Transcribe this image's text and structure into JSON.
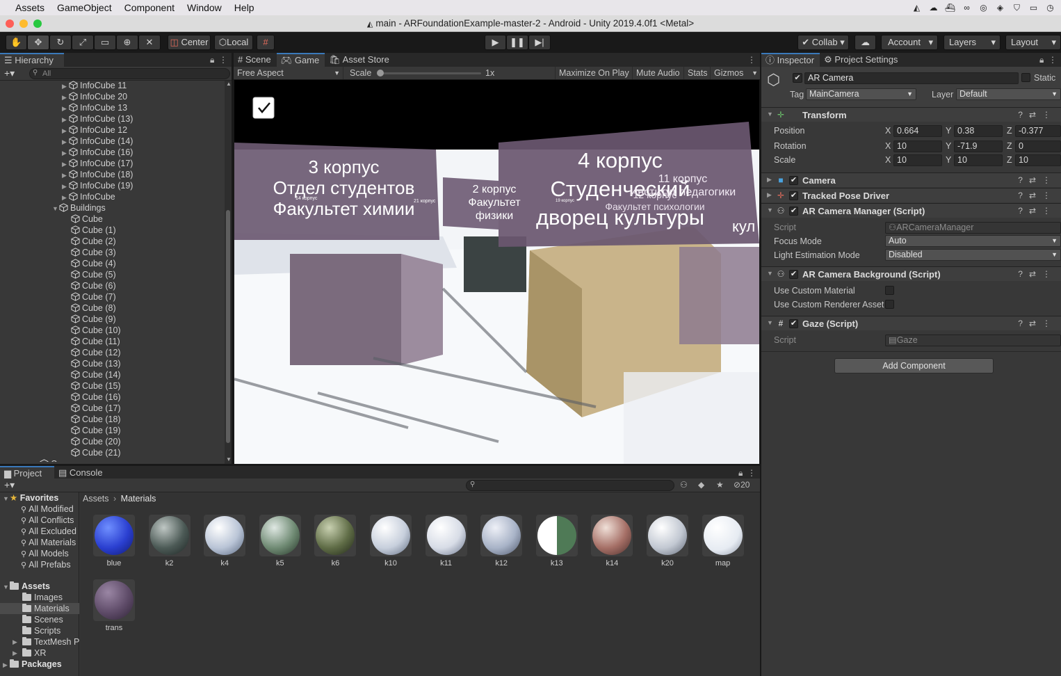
{
  "menubar": {
    "items": [
      "Assets",
      "GameObject",
      "Component",
      "Window",
      "Help"
    ],
    "tray_icons": [
      "unity-icon",
      "cloud-upload-icon",
      "docker-icon",
      "creative-cloud-icon",
      "vpn-icon",
      "dropbox-icon",
      "shield-icon",
      "display-icon",
      "clock-icon"
    ]
  },
  "window": {
    "title": "main - ARFoundationExample-master-2 - Android - Unity 2019.4.0f1 <Metal>"
  },
  "toolbar": {
    "pivot_center": "Center",
    "pivot_local": "Local",
    "collab": "Collab",
    "account": "Account",
    "layers": "Layers",
    "layout": "Layout"
  },
  "hierarchy": {
    "tab": "Hierarchy",
    "search_placeholder": "All",
    "info_items": [
      "InfoCube 11",
      "InfoCube 20",
      "InfoCube 13",
      "InfoCube (13)",
      "InfoCube 12",
      "InfoCube (14)",
      "InfoCube (16)",
      "InfoCube (17)",
      "InfoCube (18)",
      "InfoCube (19)",
      "InfoCube"
    ],
    "group": "Buildings",
    "cube_items": [
      "Cube",
      "Cube (1)",
      "Cube (2)",
      "Cube (3)",
      "Cube (4)",
      "Cube (5)",
      "Cube (6)",
      "Cube (7)",
      "Cube (8)",
      "Cube (9)",
      "Cube (10)",
      "Cube (11)",
      "Cube (12)",
      "Cube (13)",
      "Cube (14)",
      "Cube (15)",
      "Cube (16)",
      "Cube (17)",
      "Cube (18)",
      "Cube (19)",
      "Cube (20)",
      "Cube (21)"
    ],
    "partial_item": "Canvas"
  },
  "center_tabs": {
    "scene": "Scene",
    "game": "Game",
    "asset_store": "Asset Store"
  },
  "game_controls": {
    "aspect": "Free Aspect",
    "scale_label": "Scale",
    "scale_value": "1x",
    "maximize": "Maximize On Play",
    "mute": "Mute Audio",
    "stats": "Stats",
    "gizmos": "Gizmos"
  },
  "viewport_labels": {
    "sign3_line1": "3 корпус",
    "sign3_line2": "Отдел студентов",
    "sign3_line3": "Факультет химии",
    "sign2_line1": "2 корпус",
    "sign2_line2": "Факультет",
    "sign2_line3": "физики",
    "sign4_line1": "4 корпус",
    "sign4_line2": "Студенческий",
    "sign4_line3": "дворец культуры",
    "sign11_line1": "11 корпус",
    "sign11_line2": "Институт педагогики",
    "sign12_line1": "12 корпус",
    "sign12_line2": "Факультет психологии",
    "sign_right": "кул",
    "tiny_14": "14 корпус",
    "tiny_21": "21 корпус",
    "tiny_19": "19 корпус"
  },
  "inspector": {
    "tabs": {
      "inspector": "Inspector",
      "project_settings": "Project Settings"
    },
    "object_name": "AR Camera",
    "static_label": "Static",
    "tag_label": "Tag",
    "tag_value": "MainCamera",
    "layer_label": "Layer",
    "layer_value": "Default",
    "transform": {
      "title": "Transform",
      "position_label": "Position",
      "rotation_label": "Rotation",
      "scale_label": "Scale",
      "axis_x": "X",
      "axis_y": "Y",
      "axis_z": "Z",
      "position": {
        "x": "0.664",
        "y": "0.38",
        "z": "-0.377"
      },
      "rotation": {
        "x": "10",
        "y": "-71.9",
        "z": "0"
      },
      "scale": {
        "x": "10",
        "y": "10",
        "z": "10"
      }
    },
    "camera": "Camera",
    "tracked_pose": "Tracked Pose Driver",
    "ar_camera_manager": {
      "title": "AR Camera Manager (Script)",
      "script_label": "Script",
      "script_value": "ARCameraManager",
      "focus_label": "Focus Mode",
      "focus_value": "Auto",
      "light_label": "Light Estimation Mode",
      "light_value": "Disabled"
    },
    "ar_camera_background": {
      "title": "AR Camera Background (Script)",
      "custom_material": "Use Custom Material",
      "custom_renderer": "Use Custom Renderer Asset"
    },
    "gaze": {
      "title": "Gaze (Script)",
      "script_label": "Script",
      "script_value": "Gaze"
    },
    "add_component": "Add Component"
  },
  "project": {
    "tabs": {
      "project": "Project",
      "console": "Console"
    },
    "hidden_count": "20",
    "breadcrumb": {
      "root": "Assets",
      "current": "Materials"
    },
    "favorites_title": "Favorites",
    "favorites": [
      "All Modified",
      "All Conflicts",
      "All Excluded",
      "All Materials",
      "All Models",
      "All Prefabs"
    ],
    "assets_title": "Assets",
    "asset_folders": [
      "Images",
      "Materials",
      "Scenes",
      "Scripts",
      "TextMesh P",
      "XR"
    ],
    "packages": "Packages",
    "materials": [
      "blue",
      "k2",
      "k4",
      "k5",
      "k6",
      "k10",
      "k11",
      "k12",
      "k13",
      "k14",
      "k20",
      "map",
      "trans"
    ]
  },
  "colors": {
    "accent": "#3a79bb",
    "panel": "#383838",
    "header": "#282828",
    "checkbox_gray": "#e8e8e8"
  }
}
